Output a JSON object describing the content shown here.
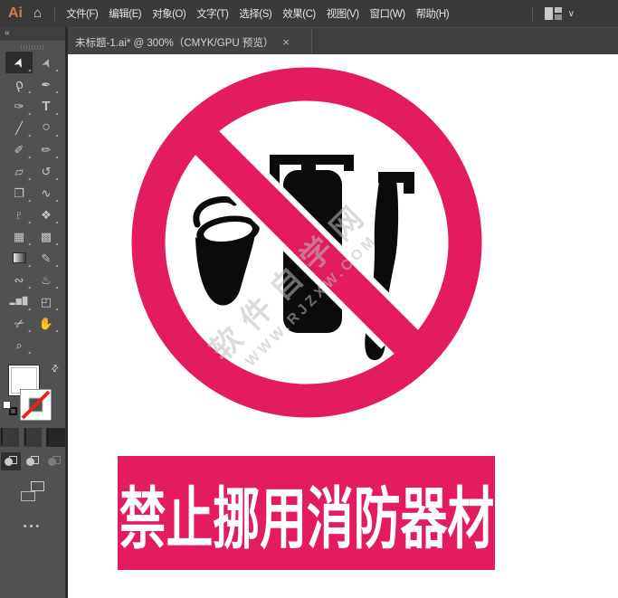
{
  "app": {
    "logo": "Ai"
  },
  "menubar": {
    "items": [
      "文件(F)",
      "编辑(E)",
      "对象(O)",
      "文字(T)",
      "选择(S)",
      "效果(C)",
      "视图(V)",
      "窗口(W)",
      "帮助(H)"
    ],
    "workspace_chevron": "∨"
  },
  "docbar": {
    "tab": {
      "title": "未标题-1.ai* @ 300%（CMYK/GPU 预览）",
      "close": "×"
    }
  },
  "toolbar": {
    "collapse": "«",
    "active_tool": "selection-tool",
    "tools": [
      {
        "name": "selection-tool",
        "glyph": "➤"
      },
      {
        "name": "direct-selection-tool",
        "glyph": "➤"
      },
      {
        "name": "lasso-tool",
        "glyph": "ρ"
      },
      {
        "name": "pen-tool",
        "glyph": "✒"
      },
      {
        "name": "curvature-tool",
        "glyph": "✑"
      },
      {
        "name": "type-tool",
        "glyph": "T"
      },
      {
        "name": "line-segment-tool",
        "glyph": "╱"
      },
      {
        "name": "ellipse-tool",
        "glyph": "○"
      },
      {
        "name": "paintbrush-tool",
        "glyph": "✐"
      },
      {
        "name": "pencil-tool",
        "glyph": "✏"
      },
      {
        "name": "eraser-tool",
        "glyph": "▱"
      },
      {
        "name": "rotate-tool",
        "glyph": "↺"
      },
      {
        "name": "scale-tool",
        "glyph": "❐"
      },
      {
        "name": "width-tool",
        "glyph": "∿"
      },
      {
        "name": "puppet-warp-tool",
        "glyph": "♇"
      },
      {
        "name": "shape-builder-tool",
        "glyph": "❖"
      },
      {
        "name": "perspective-grid-tool",
        "glyph": "▦"
      },
      {
        "name": "mesh-tool",
        "glyph": "▩"
      },
      {
        "name": "gradient-tool",
        "glyph": ""
      },
      {
        "name": "eyedropper-tool",
        "glyph": "✎"
      },
      {
        "name": "blend-tool",
        "glyph": "∾"
      },
      {
        "name": "symbol-sprayer-tool",
        "glyph": "♨"
      },
      {
        "name": "column-graph-tool",
        "glyph": "▂▆█"
      },
      {
        "name": "artboard-tool",
        "glyph": "◰"
      },
      {
        "name": "slice-tool",
        "glyph": "✂"
      },
      {
        "name": "hand-tool",
        "glyph": "✋"
      },
      {
        "name": "zoom-tool",
        "glyph": "⌕"
      }
    ]
  },
  "colors": {
    "pink": "#e31c5f",
    "symbol_black": "#0b0b0b",
    "none_red": "#e8261a",
    "canvas_white": "#ffffff"
  },
  "canvas": {
    "sign": {
      "type": "prohibition-sign",
      "symbols": [
        "fire-bucket",
        "fire-extinguisher",
        "co2-extinguisher"
      ]
    },
    "watermark": {
      "line1": "软件自学网",
      "line2": "WWW.RJZXW.COM"
    },
    "banner": {
      "text": "禁止挪用消防器材"
    }
  }
}
